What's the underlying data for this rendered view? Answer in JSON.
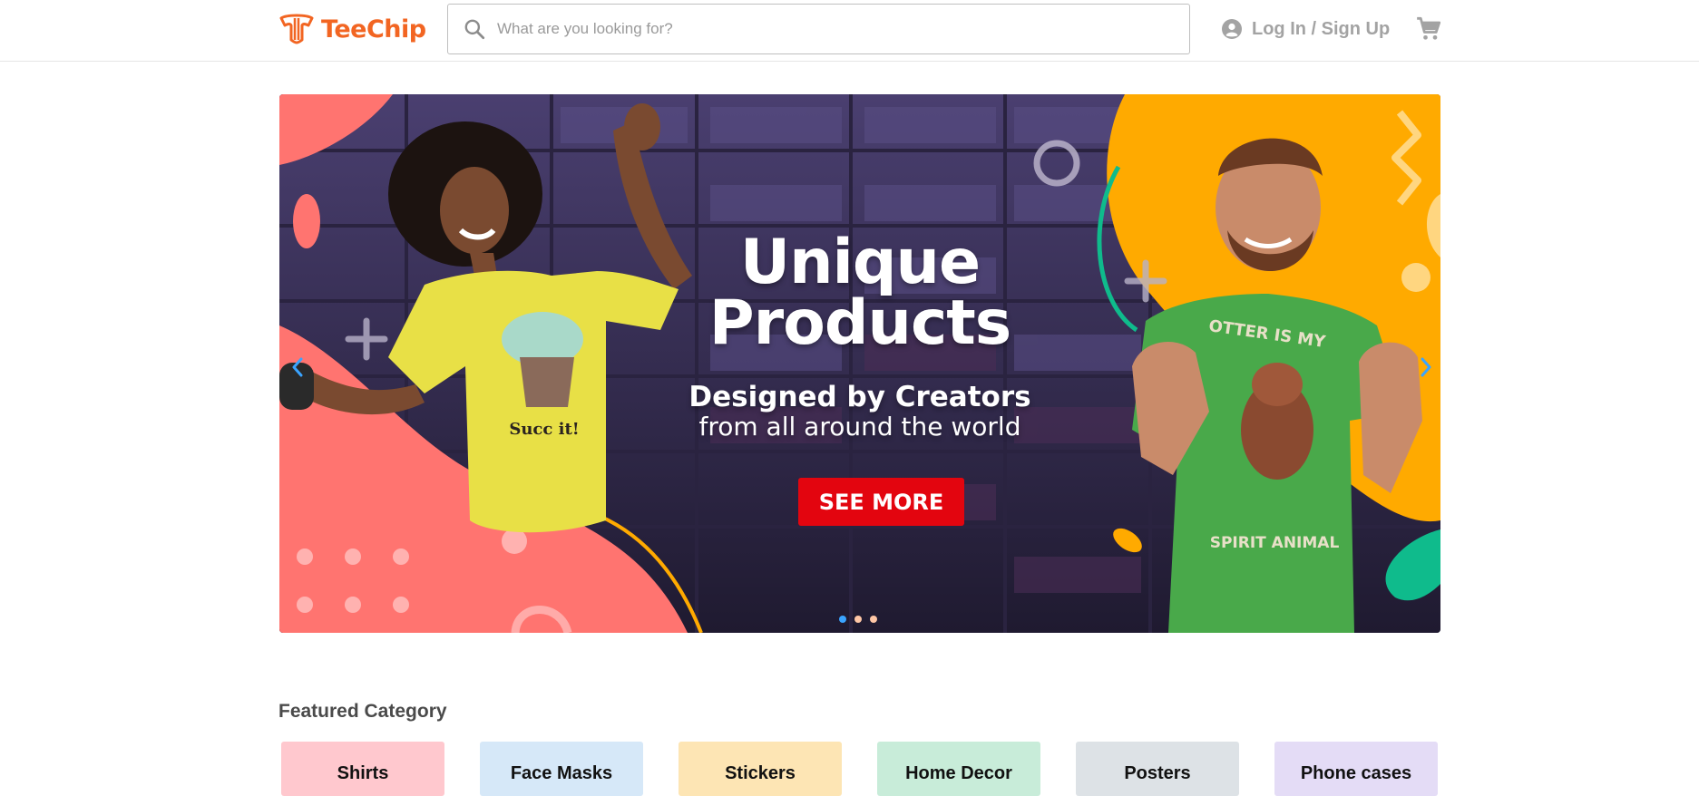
{
  "header": {
    "brand": "TeeChip",
    "search_placeholder": "What are you looking for?",
    "login_label": "Log In / Sign Up",
    "icons": [
      "teechip-logo-icon",
      "search-icon",
      "user-account-icon",
      "shopping-cart-icon"
    ]
  },
  "hero": {
    "title_line1": "Unique",
    "title_line2": "Products",
    "subtitle": "Designed by Creators",
    "tagline": "from all around the world",
    "cta_label": "SEE MORE",
    "shirt_left_text": "Succ it!",
    "shirt_right_text_top": "OTTER IS MY",
    "shirt_right_text_bottom": "SPIRIT ANIMAL",
    "slide_count": 3,
    "active_slide": 1
  },
  "featured": {
    "title": "Featured Category",
    "categories": [
      {
        "label": "Shirts",
        "color": "#ffc8ce"
      },
      {
        "label": "Face Masks",
        "color": "#d6e8f8"
      },
      {
        "label": "Stickers",
        "color": "#fde5b4"
      },
      {
        "label": "Home Decor",
        "color": "#c8ecd9"
      },
      {
        "label": "Posters",
        "color": "#dde2e6"
      },
      {
        "label": "Phone cases",
        "color": "#e4dcf6"
      }
    ]
  },
  "colors": {
    "brand": "#f26522",
    "cta": "#e3050f",
    "hero_bg": "#2e2746",
    "hero_coral": "#ff7470",
    "hero_orange": "#ffaa00",
    "hero_teal": "#0fbb8c"
  }
}
